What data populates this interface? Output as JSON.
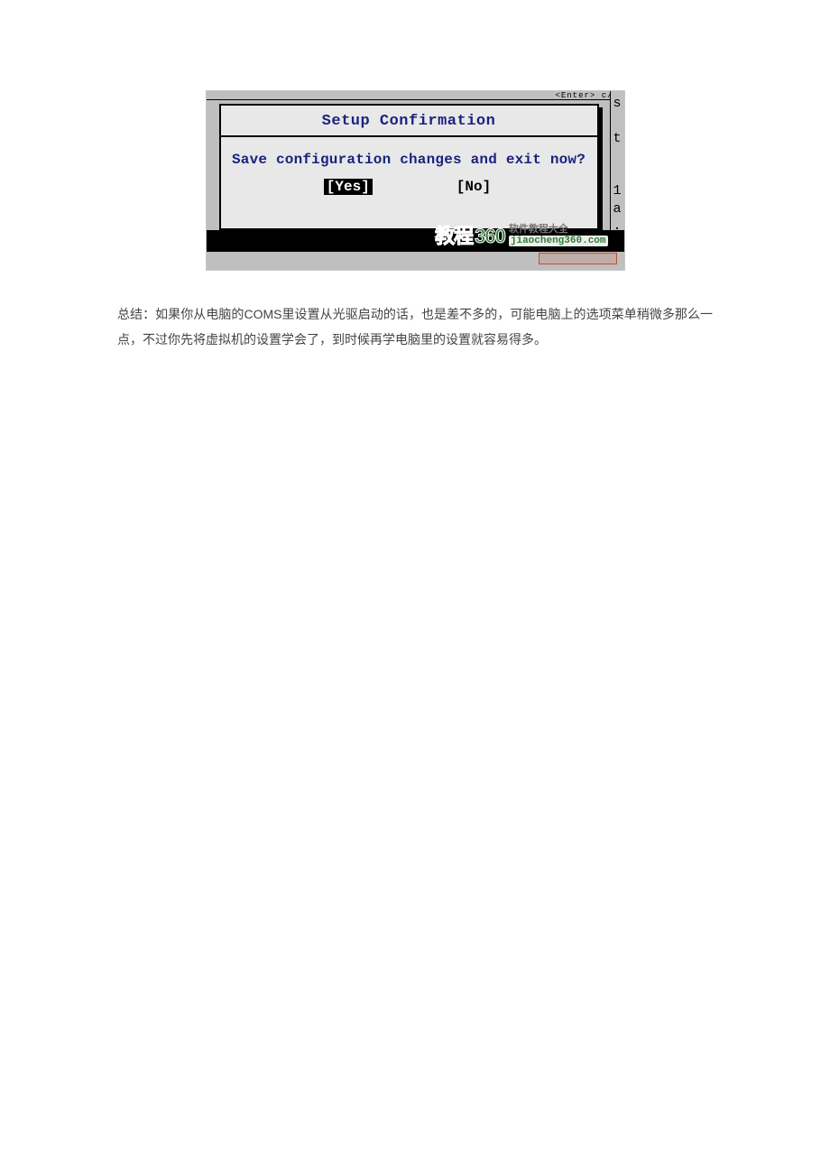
{
  "bios": {
    "topbar_hint": "<Enter>  c/",
    "right_strip": [
      "s",
      "",
      "t",
      "",
      "",
      "1",
      "a",
      "."
    ],
    "dialog": {
      "title": "Setup Confirmation",
      "body": "Save configuration changes and exit now?",
      "yes_label": "[Yes]",
      "no_label": "[No]"
    },
    "watermark": {
      "big_cn": "教程",
      "big_num": "360",
      "small_top": "软件教程大全",
      "small_bottom": "jiaocheng360.com"
    }
  },
  "article": {
    "summary": "总结：如果你从电脑的COMS里设置从光驱启动的话，也是差不多的，可能电脑上的选项菜单稍微多那么一点，不过你先将虚拟机的设置学会了，到时候再学电脑里的设置就容易得多。"
  }
}
